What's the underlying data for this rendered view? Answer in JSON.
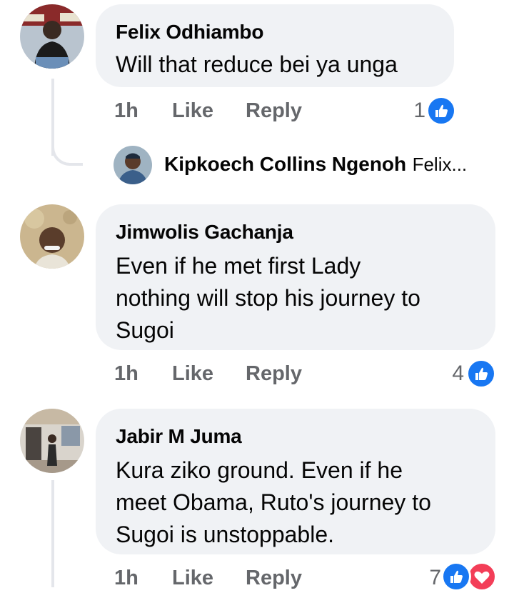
{
  "comments": [
    {
      "author": "Felix Odhiambo",
      "text": "Will that reduce bei ya unga",
      "time": "1h",
      "like": "Like",
      "reply": "Reply",
      "reactions": "1"
    },
    {
      "author": "Jimwolis Gachanja",
      "text_lines": [
        "Even if he met first Lady",
        "nothing will stop his journey to",
        "Sugoi"
      ],
      "time": "1h",
      "like": "Like",
      "reply": "Reply",
      "reactions": "4"
    },
    {
      "author": "Jabir M Juma",
      "text_lines": [
        "Kura ziko ground. Even if he",
        "meet Obama, Ruto's journey to",
        "Sugoi is unstoppable."
      ],
      "time": "1h",
      "like": "Like",
      "reply": "Reply",
      "reactions": "7"
    }
  ],
  "reply_preview": {
    "author": "Kipkoech Collins Ngenoh",
    "snippet": "Felix..."
  },
  "colors": {
    "bubble": "#f0f2f5",
    "meta": "#65676b",
    "like_blue": "#1877f2",
    "love_red": "#f33e58",
    "thread_line": "#e4e6eb"
  },
  "icons": [
    "like-reaction-icon",
    "love-reaction-icon"
  ]
}
